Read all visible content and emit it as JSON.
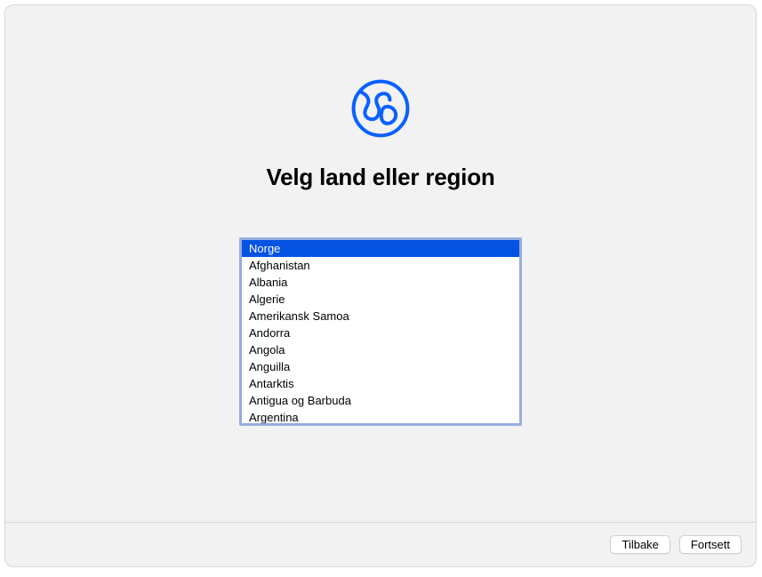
{
  "title": "Velg land eller region",
  "countries": [
    {
      "name": "Norge",
      "selected": true
    },
    {
      "name": "Afghanistan",
      "selected": false
    },
    {
      "name": "Albania",
      "selected": false
    },
    {
      "name": "Algerie",
      "selected": false
    },
    {
      "name": "Amerikansk Samoa",
      "selected": false
    },
    {
      "name": "Andorra",
      "selected": false
    },
    {
      "name": "Angola",
      "selected": false
    },
    {
      "name": "Anguilla",
      "selected": false
    },
    {
      "name": "Antarktis",
      "selected": false
    },
    {
      "name": "Antigua og Barbuda",
      "selected": false
    },
    {
      "name": "Argentina",
      "selected": false
    }
  ],
  "footer": {
    "back_label": "Tilbake",
    "continue_label": "Fortsett"
  },
  "colors": {
    "accent": "#0352e2",
    "list_border": "#94aee0",
    "window_bg": "#f2f2f2"
  }
}
